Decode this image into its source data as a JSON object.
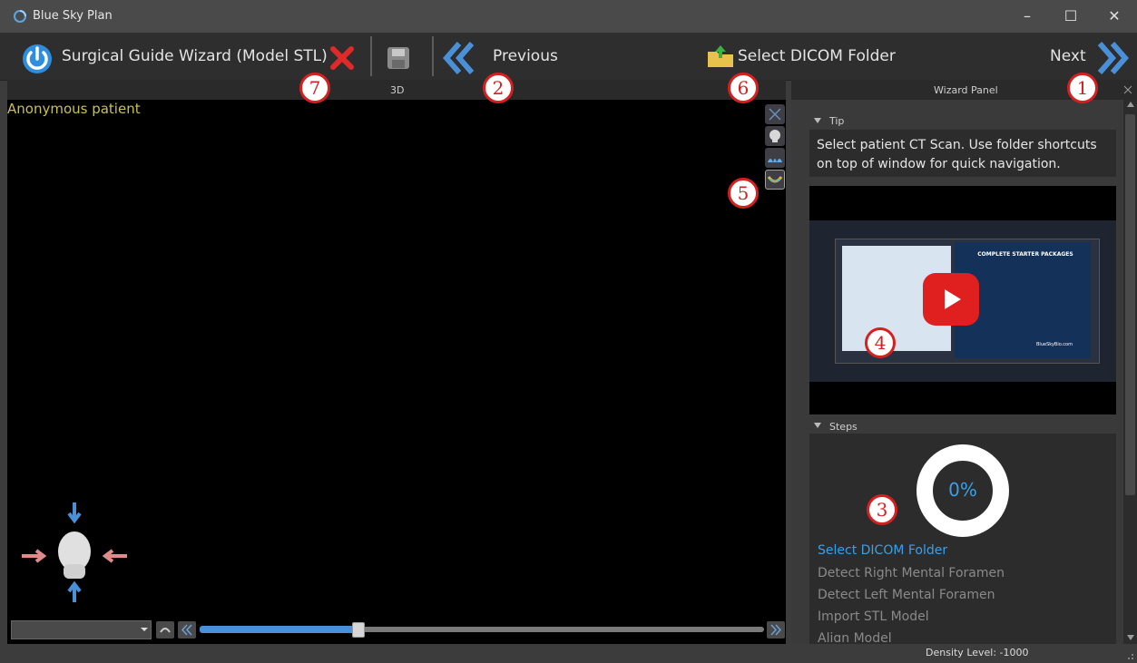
{
  "window": {
    "title": "Blue Sky Plan",
    "controls": {
      "minimize": "–",
      "maximize": "☐",
      "close": "✕"
    }
  },
  "toolbar": {
    "wizard_label": "Surgical Guide Wizard (Model STL)",
    "previous_label": "Previous",
    "select_folder_label": "Select DICOM Folder",
    "next_label": "Next"
  },
  "annotations": {
    "n1": "1",
    "n2": "2",
    "n3": "3",
    "n4": "4",
    "n5": "5",
    "n6": "6",
    "n7": "7"
  },
  "viewport": {
    "tab_title": "3D",
    "patient_label": "Anonymous patient"
  },
  "slider": {
    "value_fraction": 0.28
  },
  "wizard_panel": {
    "title": "Wizard Panel",
    "tip_section": "Tip",
    "tip_text": "Select patient CT Scan. Use folder shortcuts on top of window for quick navigation.",
    "video": {
      "headline": "COMPLETE STARTER PACKAGES",
      "brand": "BlueSkyBio.com"
    },
    "steps_section": "Steps",
    "progress": "0%",
    "steps": [
      {
        "label": "Select DICOM Folder",
        "active": true
      },
      {
        "label": "Detect Right Mental Foramen",
        "active": false
      },
      {
        "label": "Detect Left Mental Foramen",
        "active": false
      },
      {
        "label": "Import STL Model",
        "active": false
      },
      {
        "label": "Align Model",
        "active": false
      }
    ]
  },
  "status": {
    "density": "Density Level: -1000"
  },
  "colors": {
    "accent": "#4a90d9",
    "annotation_red": "#d62020",
    "patient_text": "#c9c24a",
    "active_step": "#3aa0e8"
  }
}
